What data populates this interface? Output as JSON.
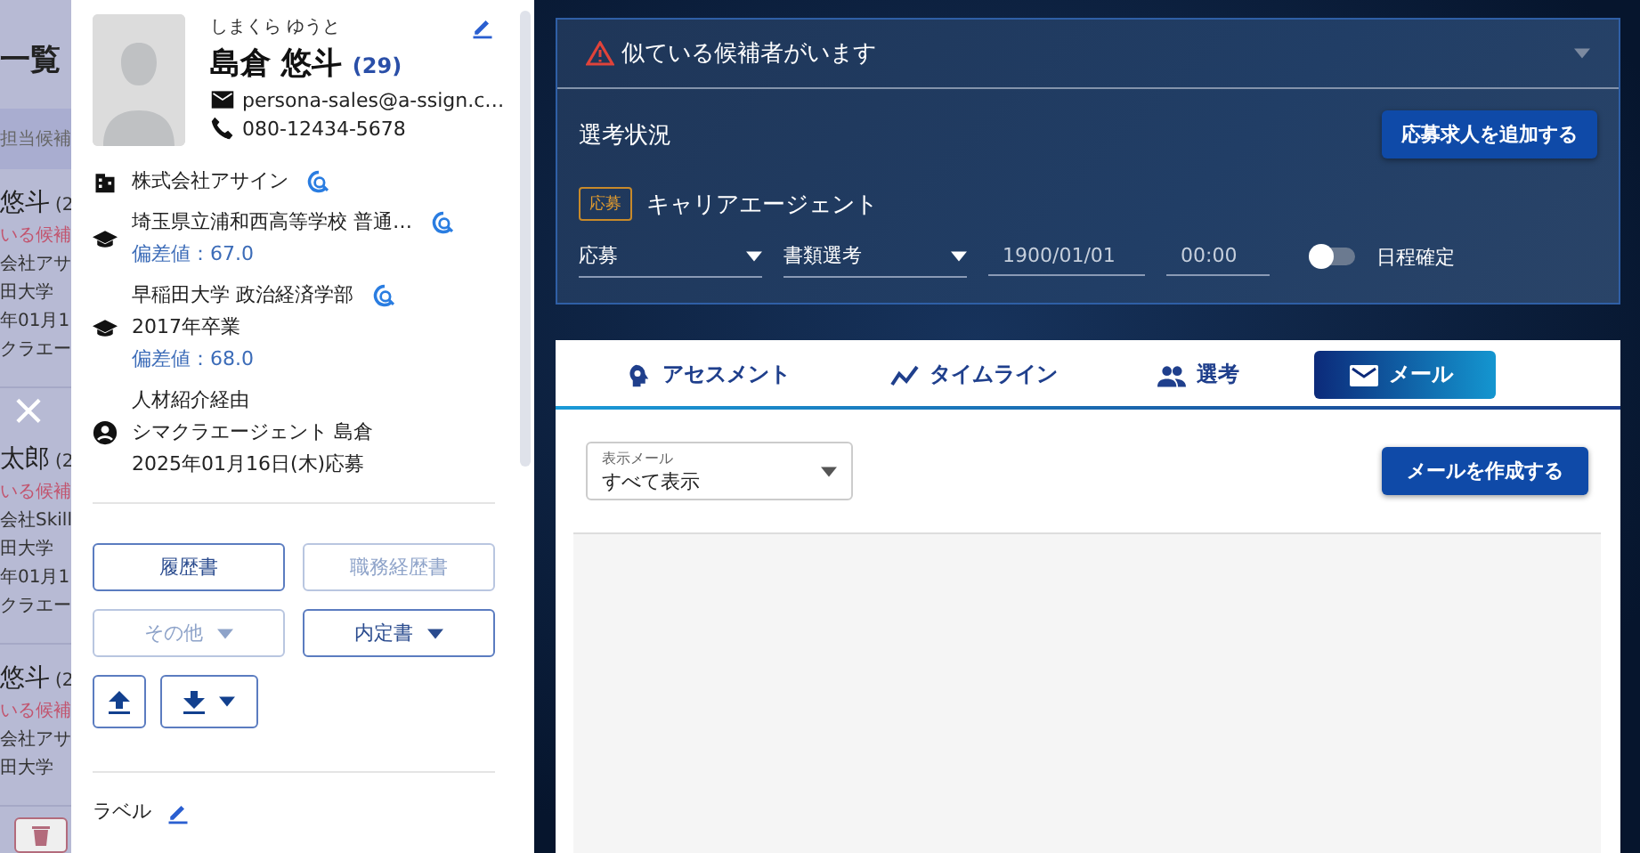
{
  "background_list": {
    "title": "一覧",
    "filter": "担当候補",
    "items": [
      {
        "name": "悠斗",
        "age": "(2",
        "lines": [
          "いる候補",
          "会社アサ",
          "田大学",
          "年01月1",
          "クラエー"
        ]
      },
      {
        "name": "太郎",
        "age": "(2",
        "lines": [
          "いる候補",
          "会社Skill",
          "田大学",
          "年01月1",
          "クラエー"
        ]
      },
      {
        "name": "悠斗",
        "age": "(2",
        "lines": [
          "いる候補",
          "会社アサ",
          "田大学"
        ]
      }
    ]
  },
  "candidate": {
    "furigana": "しまくら ゆうと",
    "name": "島倉 悠斗",
    "age": "(29)",
    "email": "persona-sales@a-ssign.c…",
    "phone": "080-12434-5678",
    "company": "株式会社アサイン",
    "schools": [
      {
        "name": "埼玉県立浦和西高等学校 普通…",
        "deviation": "偏差値：67.0"
      },
      {
        "name": "早稲田大学 政治経済学部",
        "lines": [
          "2017年卒業"
        ],
        "deviation": "偏差値：68.0"
      }
    ],
    "source": [
      "人材紹介経由",
      "シマクラエージェント 島倉",
      "2025年01月16日(木)応募"
    ],
    "documents": [
      {
        "label": "履歴書",
        "disabled": false,
        "kind": "plain"
      },
      {
        "label": "職務経歴書",
        "disabled": true,
        "kind": "plain"
      },
      {
        "label": "その他",
        "disabled": true,
        "kind": "menu"
      },
      {
        "label": "内定書",
        "disabled": false,
        "kind": "menu"
      }
    ],
    "label_field": "ラベル"
  },
  "alert": {
    "text": "似ている候補者がいます",
    "expanded": false
  },
  "selection": {
    "title": "選考状況",
    "add_button": "応募求人を追加する",
    "applications": [
      {
        "badge": "応募",
        "company": "キャリアエージェント",
        "route": "応募",
        "stage": "書類選考",
        "date": "1900/01/01",
        "time": "00:00",
        "schedule_label": "日程確定",
        "schedule_confirmed": false
      }
    ]
  },
  "tabs": [
    {
      "label": "アセスメント",
      "kind": "assessment",
      "selected": false
    },
    {
      "label": "タイムライン",
      "kind": "timeline",
      "selected": false
    },
    {
      "label": "選考",
      "kind": "selection",
      "selected": false
    },
    {
      "label": "メール",
      "kind": "mail",
      "selected": true
    }
  ],
  "mail": {
    "filter_label": "表示メール",
    "filter_value": "すべて表示",
    "compose_button": "メールを作成する"
  }
}
